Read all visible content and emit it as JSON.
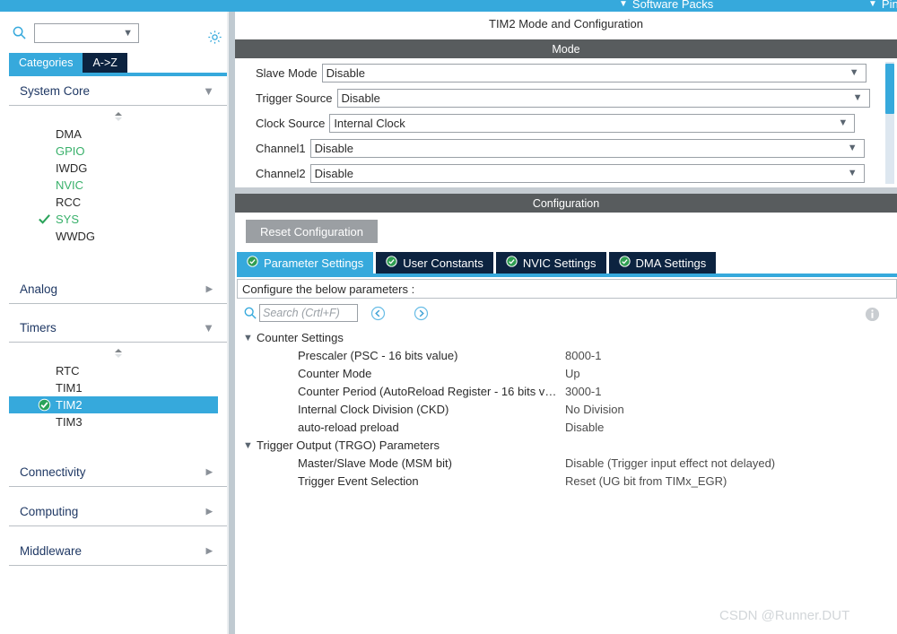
{
  "topbar": {
    "items": [
      {
        "label": "Software Packs",
        "icon": "chevron-down-icon"
      },
      {
        "label": "Pin",
        "icon": "chevron-down-icon"
      }
    ]
  },
  "sidebar": {
    "search": {
      "icon": "search-icon",
      "value": "",
      "placeholder": ""
    },
    "settings_icon": "gear-icon",
    "tabs": [
      {
        "label": "Categories",
        "active": true
      },
      {
        "label": "A->Z",
        "active": false
      }
    ],
    "groups": [
      {
        "label": "System Core",
        "expanded": true,
        "items": [
          {
            "label": "DMA",
            "state": "default",
            "checked": false
          },
          {
            "label": "GPIO",
            "state": "enabled",
            "checked": false
          },
          {
            "label": "IWDG",
            "state": "default",
            "checked": false
          },
          {
            "label": "NVIC",
            "state": "enabled",
            "checked": false
          },
          {
            "label": "RCC",
            "state": "default",
            "checked": false
          },
          {
            "label": "SYS",
            "state": "enabled",
            "checked": true
          },
          {
            "label": "WWDG",
            "state": "default",
            "checked": false
          }
        ]
      },
      {
        "label": "Analog",
        "expanded": false,
        "items": []
      },
      {
        "label": "Timers",
        "expanded": true,
        "items": [
          {
            "label": "RTC",
            "state": "default",
            "checked": false
          },
          {
            "label": "TIM1",
            "state": "default",
            "checked": false
          },
          {
            "label": "TIM2",
            "state": "selected",
            "checked": true
          },
          {
            "label": "TIM3",
            "state": "default",
            "checked": false
          }
        ]
      },
      {
        "label": "Connectivity",
        "expanded": false,
        "items": []
      },
      {
        "label": "Computing",
        "expanded": false,
        "items": []
      },
      {
        "label": "Middleware",
        "expanded": false,
        "items": []
      }
    ]
  },
  "main": {
    "title": "TIM2 Mode and Configuration",
    "mode": {
      "header": "Mode",
      "rows": [
        {
          "label": "Slave Mode",
          "value": "Disable"
        },
        {
          "label": "Trigger Source",
          "value": "Disable"
        },
        {
          "label": "Clock Source",
          "value": "Internal Clock"
        },
        {
          "label": "Channel1",
          "value": "Disable"
        },
        {
          "label": "Channel2",
          "value": "Disable"
        }
      ]
    },
    "configuration": {
      "header": "Configuration",
      "reset_label": "Reset Configuration",
      "tabs": [
        {
          "label": "Parameter Settings",
          "icon": "check-circle-icon",
          "active": true
        },
        {
          "label": "User Constants",
          "icon": "check-circle-icon",
          "active": false
        },
        {
          "label": "NVIC Settings",
          "icon": "check-circle-icon",
          "active": false
        },
        {
          "label": "DMA Settings",
          "icon": "check-circle-icon",
          "active": false
        }
      ],
      "hint": "Configure the below parameters :",
      "search": {
        "icon": "search-icon",
        "value": "",
        "placeholder": "Search (Crtl+F)",
        "prev_icon": "circle-left-arrow-icon",
        "next_icon": "circle-right-arrow-icon",
        "info_icon": "info-icon"
      },
      "parameter_groups": [
        {
          "label": "Counter Settings",
          "expanded": true,
          "params": [
            {
              "name": "Prescaler (PSC - 16 bits value)",
              "value": "8000-1"
            },
            {
              "name": "Counter Mode",
              "value": "Up"
            },
            {
              "name": "Counter Period (AutoReload Register - 16 bits val...",
              "value": "3000-1"
            },
            {
              "name": "Internal Clock Division (CKD)",
              "value": "No Division"
            },
            {
              "name": "auto-reload preload",
              "value": "Disable"
            }
          ]
        },
        {
          "label": "Trigger Output (TRGO) Parameters",
          "expanded": true,
          "params": [
            {
              "name": "Master/Slave Mode (MSM bit)",
              "value": "Disable (Trigger input effect not delayed)"
            },
            {
              "name": "Trigger Event Selection",
              "value": "Reset (UG bit from TIMx_EGR)"
            }
          ]
        }
      ]
    }
  },
  "watermark": "CSDN @Runner.DUT",
  "colors": {
    "accent_blue": "#36a9dc",
    "tab_navy": "#0c2340",
    "section_gray": "#585c5e",
    "enabled_green": "#38b06a",
    "group_label": "#1f3864"
  }
}
